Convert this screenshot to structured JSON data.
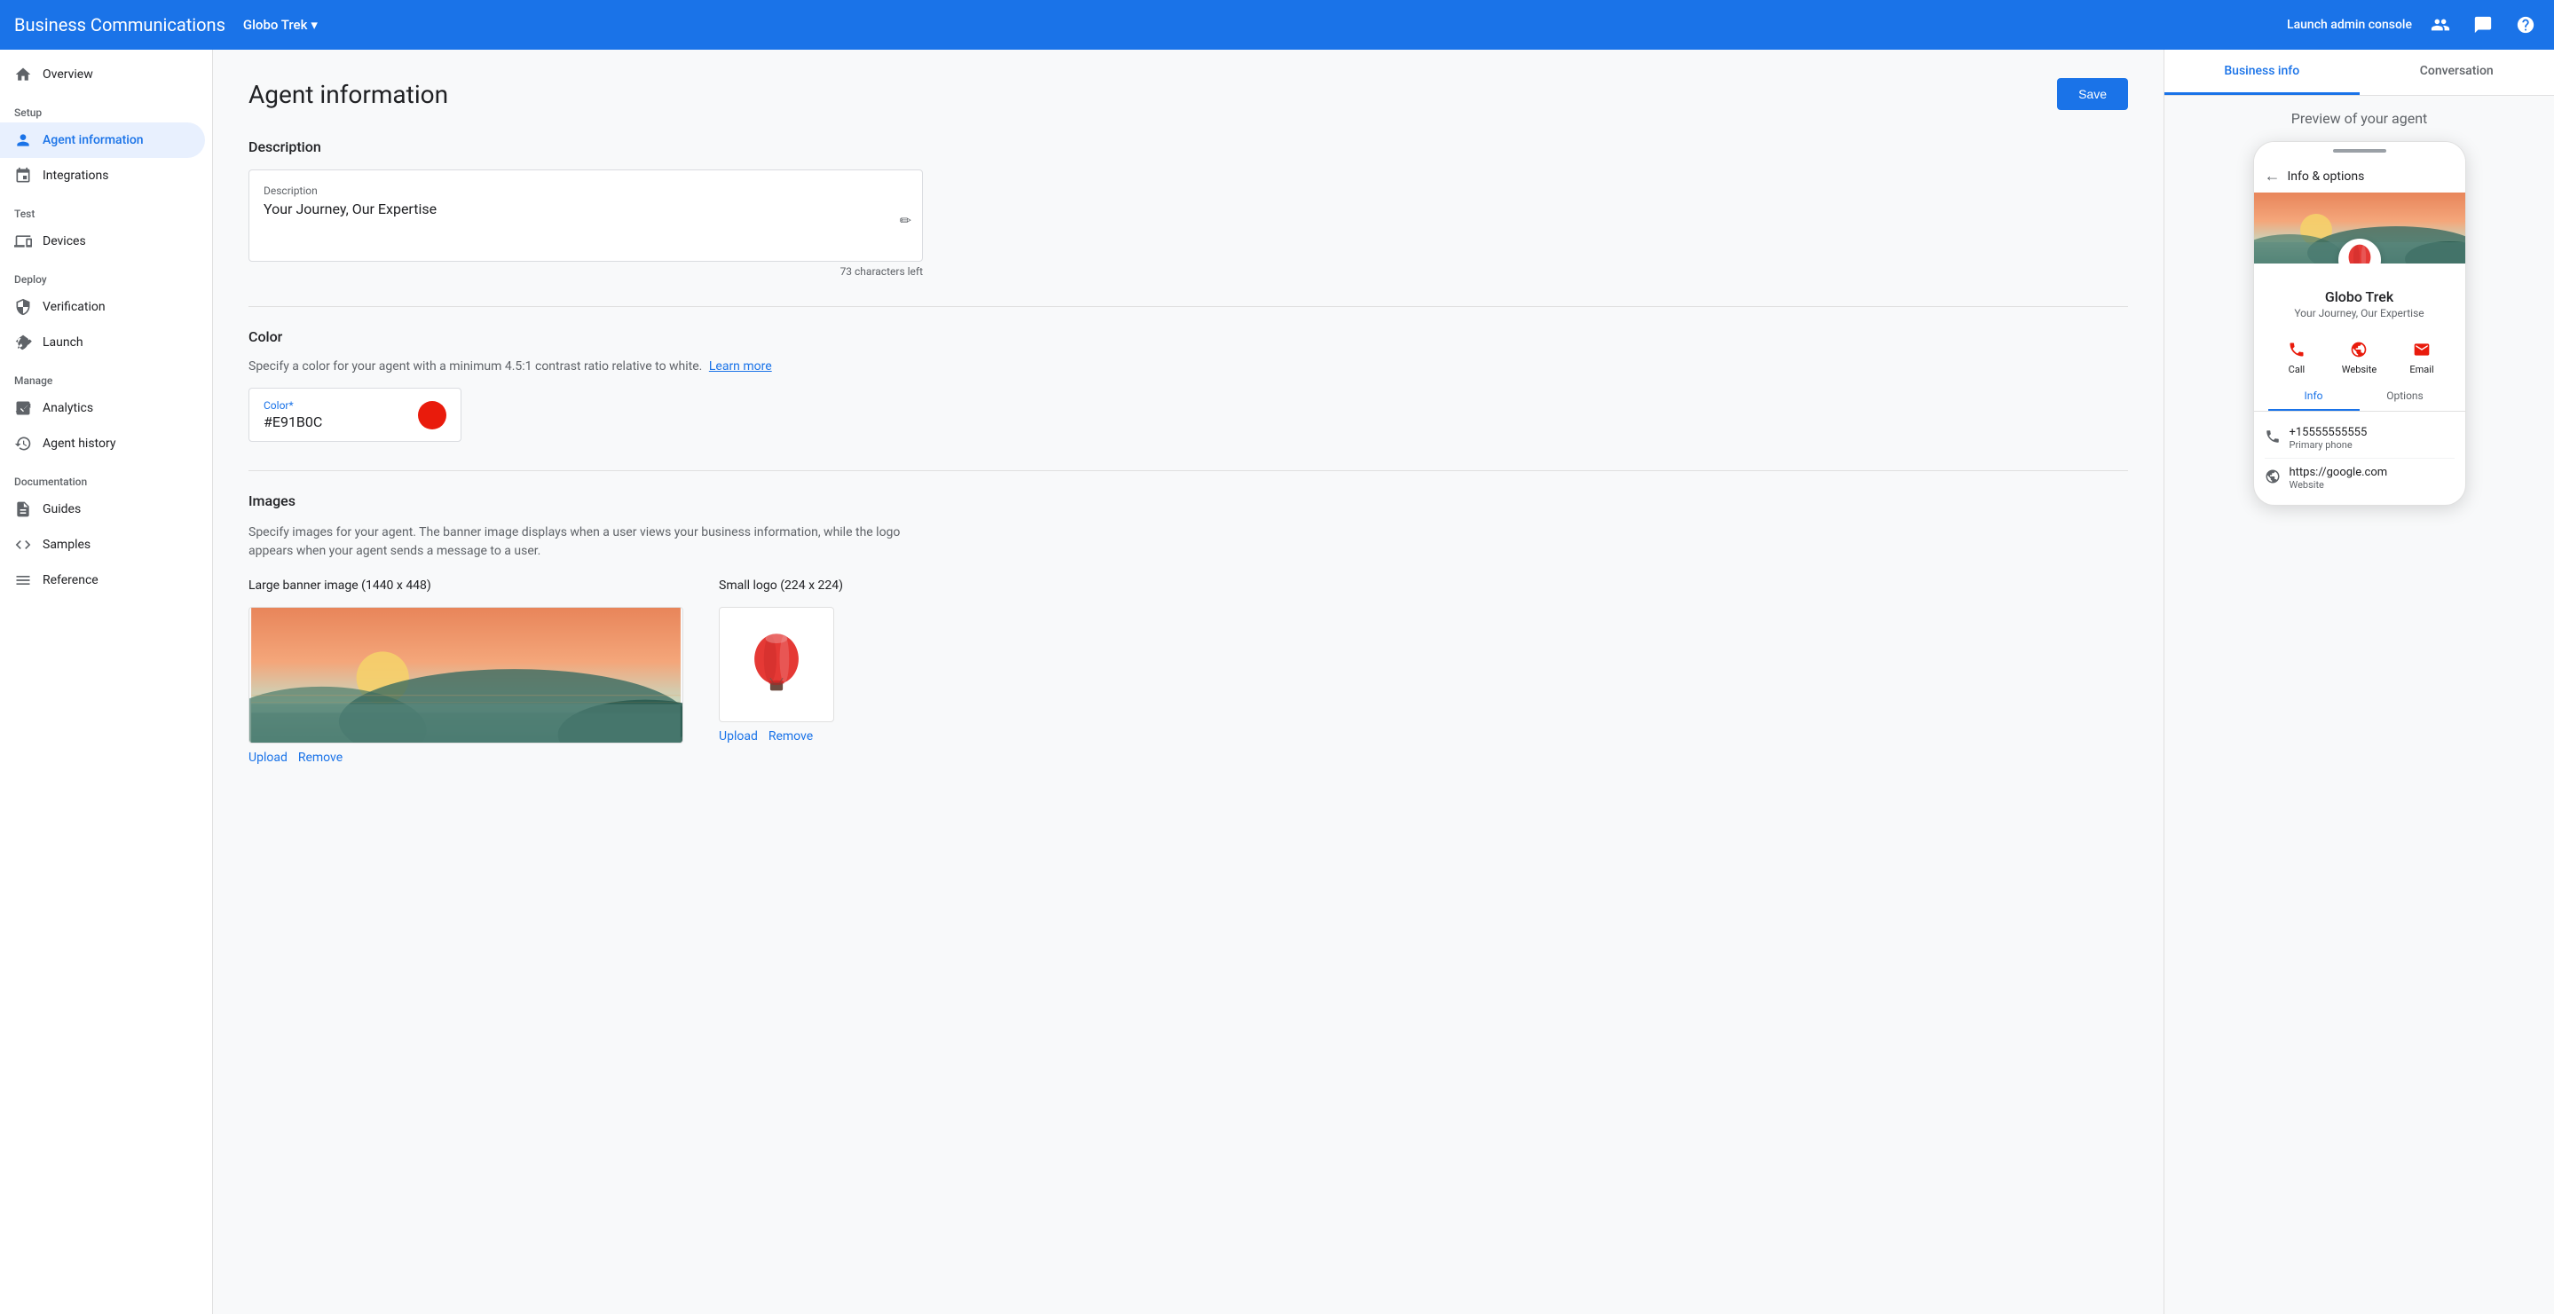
{
  "app": {
    "title": "Business Communications",
    "brand": "Globo Trek",
    "launch_console": "Launch admin console"
  },
  "sidebar": {
    "sections": [
      {
        "label": "",
        "items": [
          {
            "id": "overview",
            "label": "Overview",
            "icon": "🏠"
          }
        ]
      },
      {
        "label": "Setup",
        "items": [
          {
            "id": "agent-information",
            "label": "Agent information",
            "icon": "👤",
            "active": true
          },
          {
            "id": "integrations",
            "label": "Integrations",
            "icon": "🔗"
          }
        ]
      },
      {
        "label": "Test",
        "items": [
          {
            "id": "devices",
            "label": "Devices",
            "icon": "📱"
          }
        ]
      },
      {
        "label": "Deploy",
        "items": [
          {
            "id": "verification",
            "label": "Verification",
            "icon": "🛡️"
          },
          {
            "id": "launch",
            "label": "Launch",
            "icon": "🚀"
          }
        ]
      },
      {
        "label": "Manage",
        "items": [
          {
            "id": "analytics",
            "label": "Analytics",
            "icon": "📈"
          },
          {
            "id": "agent-history",
            "label": "Agent history",
            "icon": "🕐"
          }
        ]
      },
      {
        "label": "Documentation",
        "items": [
          {
            "id": "guides",
            "label": "Guides",
            "icon": "📄"
          },
          {
            "id": "samples",
            "label": "Samples",
            "icon": "💻"
          },
          {
            "id": "reference",
            "label": "Reference",
            "icon": "☰"
          }
        ]
      }
    ]
  },
  "main": {
    "page_title": "Agent information",
    "save_button": "Save",
    "description": {
      "section_title": "Description",
      "label": "Description",
      "value": "Your Journey, Our Expertise",
      "char_count": "73 characters left"
    },
    "color": {
      "section_title": "Color",
      "help_text": "Specify a color for your agent with a minimum 4.5:1 contrast ratio relative to white.",
      "learn_more": "Learn more",
      "field_label": "Color*",
      "value": "#E91B0C",
      "swatch_color": "#E91B0C"
    },
    "images": {
      "section_title": "Images",
      "help_text": "Specify images for your agent. The banner image displays when a user views your business information, while the logo appears when your agent sends a message to a user.",
      "banner": {
        "label": "Large banner image (1440 x 448)",
        "upload": "Upload",
        "remove": "Remove"
      },
      "logo": {
        "label": "Small logo (224 x 224)",
        "upload": "Upload",
        "remove": "Remove"
      }
    }
  },
  "right_panel": {
    "tabs": [
      {
        "id": "business-info",
        "label": "Business info",
        "active": true
      },
      {
        "id": "conversation",
        "label": "Conversation"
      }
    ],
    "preview_label": "Preview of your agent",
    "phone": {
      "header": "Info & options",
      "agent_name": "Globo Trek",
      "agent_desc": "Your Journey, Our Expertise",
      "actions": [
        {
          "label": "Call",
          "icon": "📞",
          "color": "#E91B0C"
        },
        {
          "label": "Website",
          "icon": "🌐",
          "color": "#E91B0C"
        },
        {
          "label": "Email",
          "icon": "✉️",
          "color": "#E91B0C"
        }
      ],
      "tabs": [
        {
          "label": "Info",
          "active": true
        },
        {
          "label": "Options"
        }
      ],
      "info_rows": [
        {
          "icon": "📞",
          "primary": "+15555555555",
          "secondary": "Primary phone"
        },
        {
          "icon": "🌐",
          "primary": "https://google.com",
          "secondary": "Website"
        }
      ]
    }
  }
}
